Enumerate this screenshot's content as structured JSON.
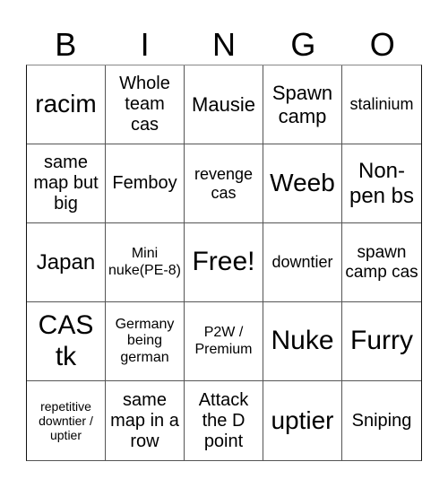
{
  "header": {
    "letters": [
      "B",
      "I",
      "N",
      "G",
      "O"
    ]
  },
  "cells": [
    [
      "racim",
      "Whole team cas",
      "Mausie",
      "Spawn camp",
      "stalinium"
    ],
    [
      "same map but big",
      "Femboy",
      "revenge cas",
      "Weeb",
      "Non-pen bs"
    ],
    [
      "Japan",
      "Mini nuke(PE-8)",
      "Free!",
      "downtier",
      "spawn camp cas"
    ],
    [
      "CAS tk",
      "Germany being german",
      "P2W / Premium",
      "Nuke",
      "Furry"
    ],
    [
      "repetitive downtier / uptier",
      "same map in a row",
      "Attack the D point",
      "uptier",
      "Sniping"
    ]
  ]
}
